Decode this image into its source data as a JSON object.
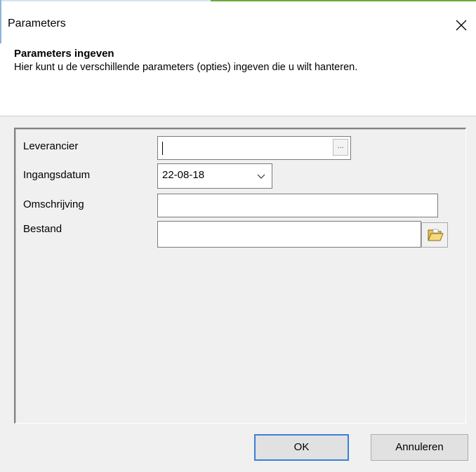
{
  "window": {
    "title": "Parameters"
  },
  "header": {
    "title": "Parameters ingeven",
    "description": "Hier kunt u de verschillende parameters (opties) ingeven die u wilt hanteren."
  },
  "form": {
    "leverancier": {
      "label": "Leverancier",
      "value": ""
    },
    "ingangsdatum": {
      "label": "Ingangsdatum",
      "value": "22-08-18"
    },
    "omschrijving": {
      "label": "Omschrijving",
      "value": ""
    },
    "bestand": {
      "label": "Bestand",
      "value": ""
    },
    "ellipsis_label": "..."
  },
  "buttons": {
    "ok": "OK",
    "cancel": "Annuleren"
  },
  "icons": {
    "close": "close-icon",
    "dropdown": "chevron-down-icon",
    "browse": "folder-open-icon"
  },
  "colors": {
    "default_button_border": "#3c7fd6",
    "panel_background": "#f0f0f0",
    "accent_top": "#6fa83d"
  }
}
